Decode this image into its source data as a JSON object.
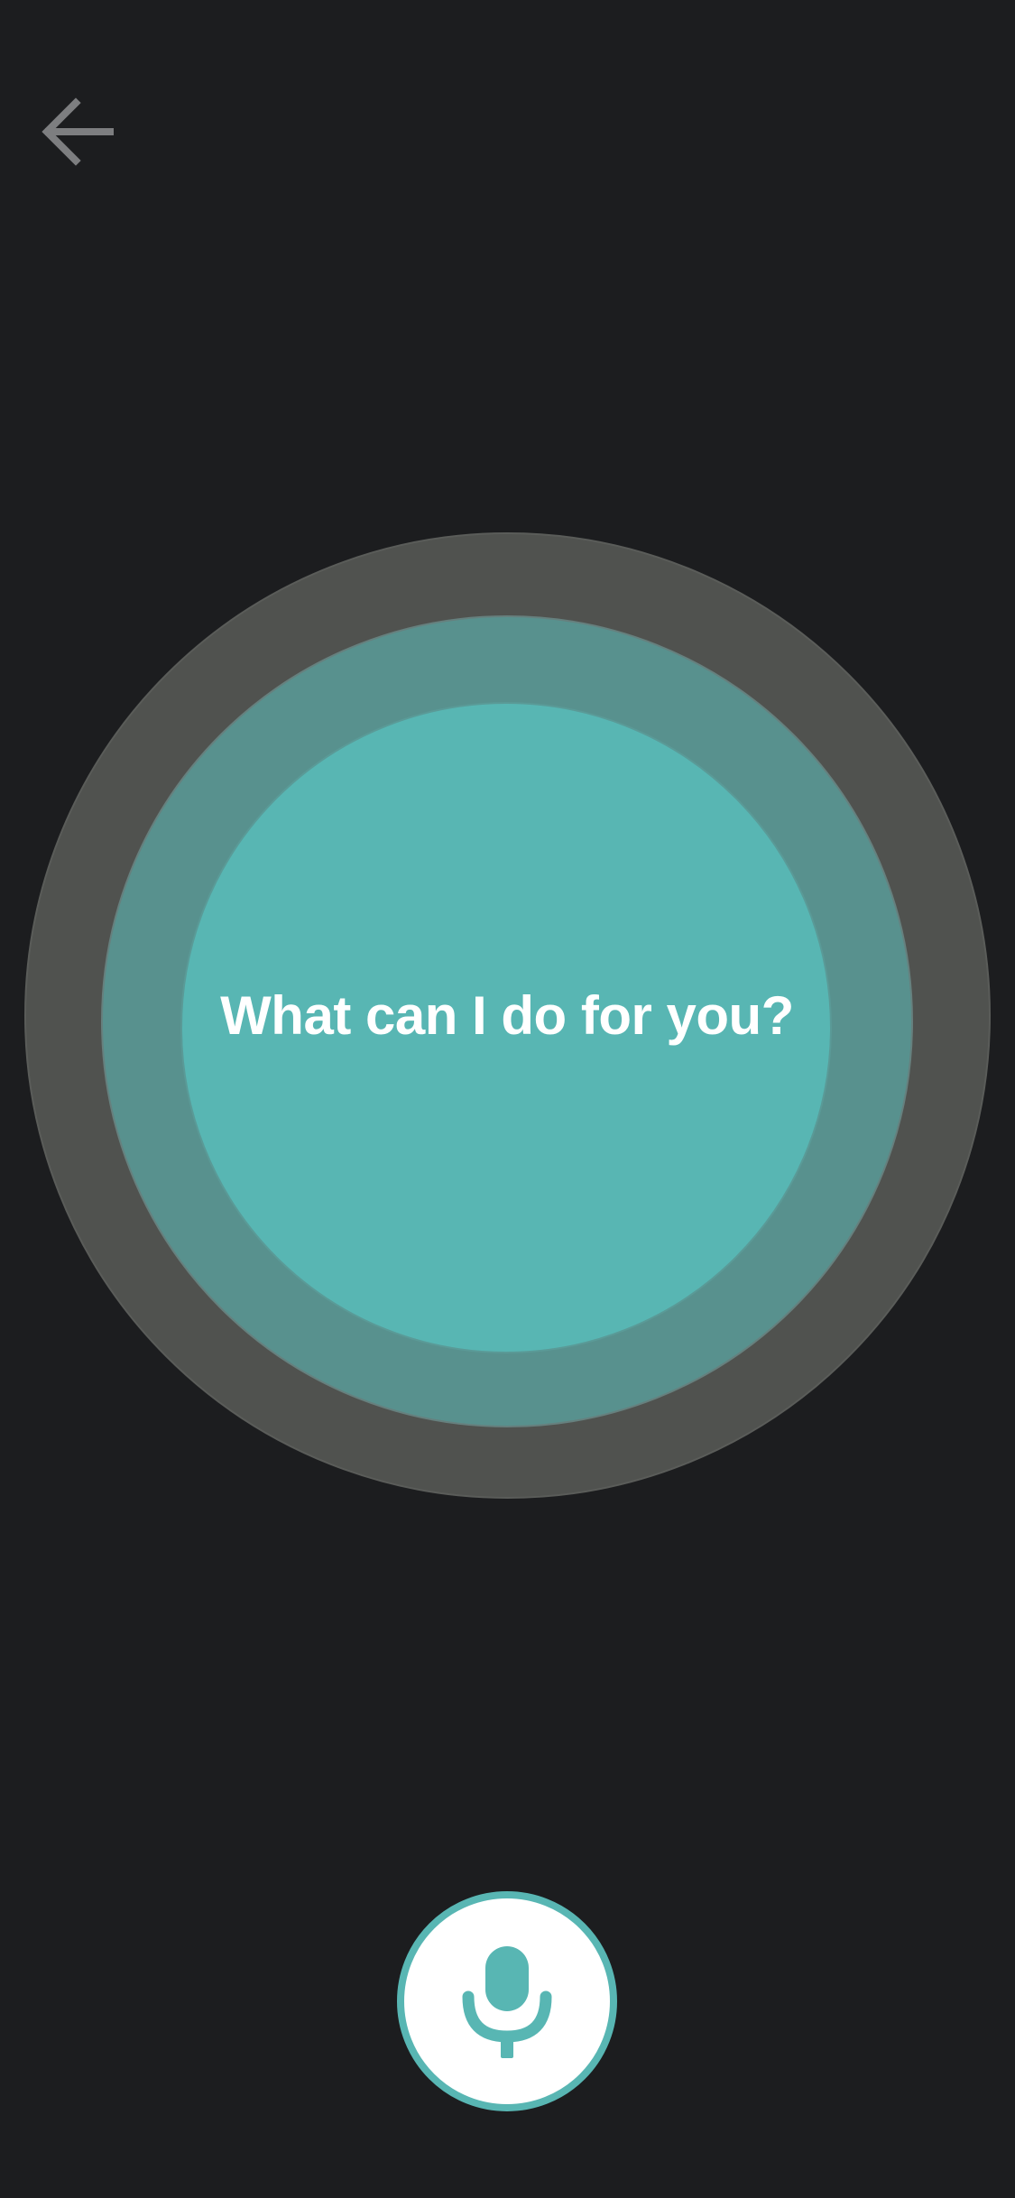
{
  "header": {
    "back_icon": "arrow-left-icon"
  },
  "assistant": {
    "prompt": "What can I do for you?"
  },
  "controls": {
    "mic_icon": "microphone-icon"
  },
  "colors": {
    "background": "#1c1d1f",
    "accent": "#58b6b3",
    "ring_outer": "#50524f",
    "ring_middle": "#58918e",
    "icon_gray": "#7d7e80",
    "text": "#ffffff"
  }
}
